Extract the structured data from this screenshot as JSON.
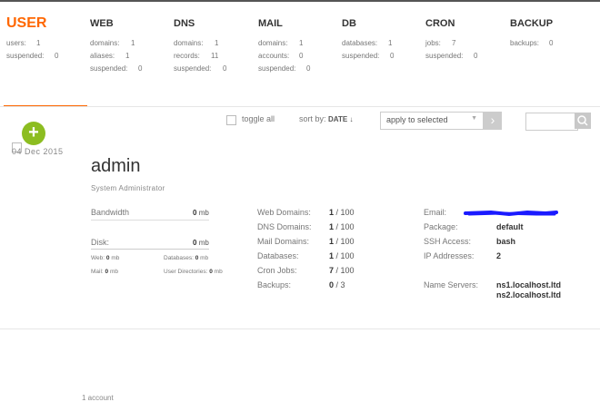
{
  "tabs": [
    {
      "id": "user",
      "title": "USER",
      "stats": [
        {
          "label": "users:",
          "value": "1"
        },
        {
          "label": "suspended:",
          "value": "0"
        }
      ]
    },
    {
      "id": "web",
      "title": "WEB",
      "stats": [
        {
          "label": "domains:",
          "value": "1"
        },
        {
          "label": "aliases:",
          "value": "1"
        },
        {
          "label": "suspended:",
          "value": "0"
        }
      ]
    },
    {
      "id": "dns",
      "title": "DNS",
      "stats": [
        {
          "label": "domains:",
          "value": "1"
        },
        {
          "label": "records:",
          "value": "11"
        },
        {
          "label": "suspended:",
          "value": "0"
        }
      ]
    },
    {
      "id": "mail",
      "title": "MAIL",
      "stats": [
        {
          "label": "domains:",
          "value": "1"
        },
        {
          "label": "accounts:",
          "value": "0"
        },
        {
          "label": "suspended:",
          "value": "0"
        }
      ]
    },
    {
      "id": "db",
      "title": "DB",
      "stats": [
        {
          "label": "databases:",
          "value": "1"
        },
        {
          "label": "suspended:",
          "value": "0"
        }
      ]
    },
    {
      "id": "cron",
      "title": "CRON",
      "stats": [
        {
          "label": "jobs:",
          "value": "7"
        },
        {
          "label": "suspended:",
          "value": "0"
        }
      ]
    },
    {
      "id": "backup",
      "title": "BACKUP",
      "stats": [
        {
          "label": "backups:",
          "value": "0"
        }
      ]
    }
  ],
  "toolbar": {
    "toggle_all": "toggle all",
    "sort_by": "sort by:",
    "sort_field": "DATE ↓",
    "apply_select": "apply to selected",
    "apply_icon": "›",
    "search_placeholder": ""
  },
  "add_button": "+",
  "user": {
    "date": "04 Dec 2015",
    "name": "admin",
    "description": "System Administrator",
    "bandwidth_label": "Bandwidth",
    "bandwidth_value": "0",
    "bandwidth_unit": "mb",
    "disk_label": "Disk:",
    "disk_value": "0",
    "disk_unit": "mb",
    "web_label": "Web:",
    "web_value": "0",
    "web_unit": "mb",
    "databases_label": "Databases:",
    "databases_value": "0",
    "databases_unit": "mb",
    "mail_label": "Mail:",
    "mail_value": "0",
    "mail_unit": "mb",
    "userdirs_label": "User Directories:",
    "userdirs_value": "0",
    "userdirs_unit": "mb",
    "stats": [
      {
        "label": "Web Domains:",
        "used": "1",
        "limit": "100"
      },
      {
        "label": "DNS Domains:",
        "used": "1",
        "limit": "100"
      },
      {
        "label": "Mail Domains:",
        "used": "1",
        "limit": "100"
      },
      {
        "label": "Databases:",
        "used": "1",
        "limit": "100"
      },
      {
        "label": "Cron Jobs:",
        "used": "7",
        "limit": "100"
      },
      {
        "label": "Backups:",
        "used": "0",
        "limit": "3"
      }
    ],
    "email_label": "Email:",
    "package_label": "Package:",
    "package_value": "default",
    "ssh_label": "SSH Access:",
    "ssh_value": "bash",
    "ip_label": "IP Addresses:",
    "ip_value": "2",
    "ns_label": "Name Servers:",
    "ns1": "ns1.localhost.ltd",
    "ns2": "ns2.localhost.ltd"
  },
  "footer": "1 account",
  "colors": {
    "accent": "#ff6701",
    "add": "#8cbd21",
    "redaction": "#1a1aff"
  }
}
